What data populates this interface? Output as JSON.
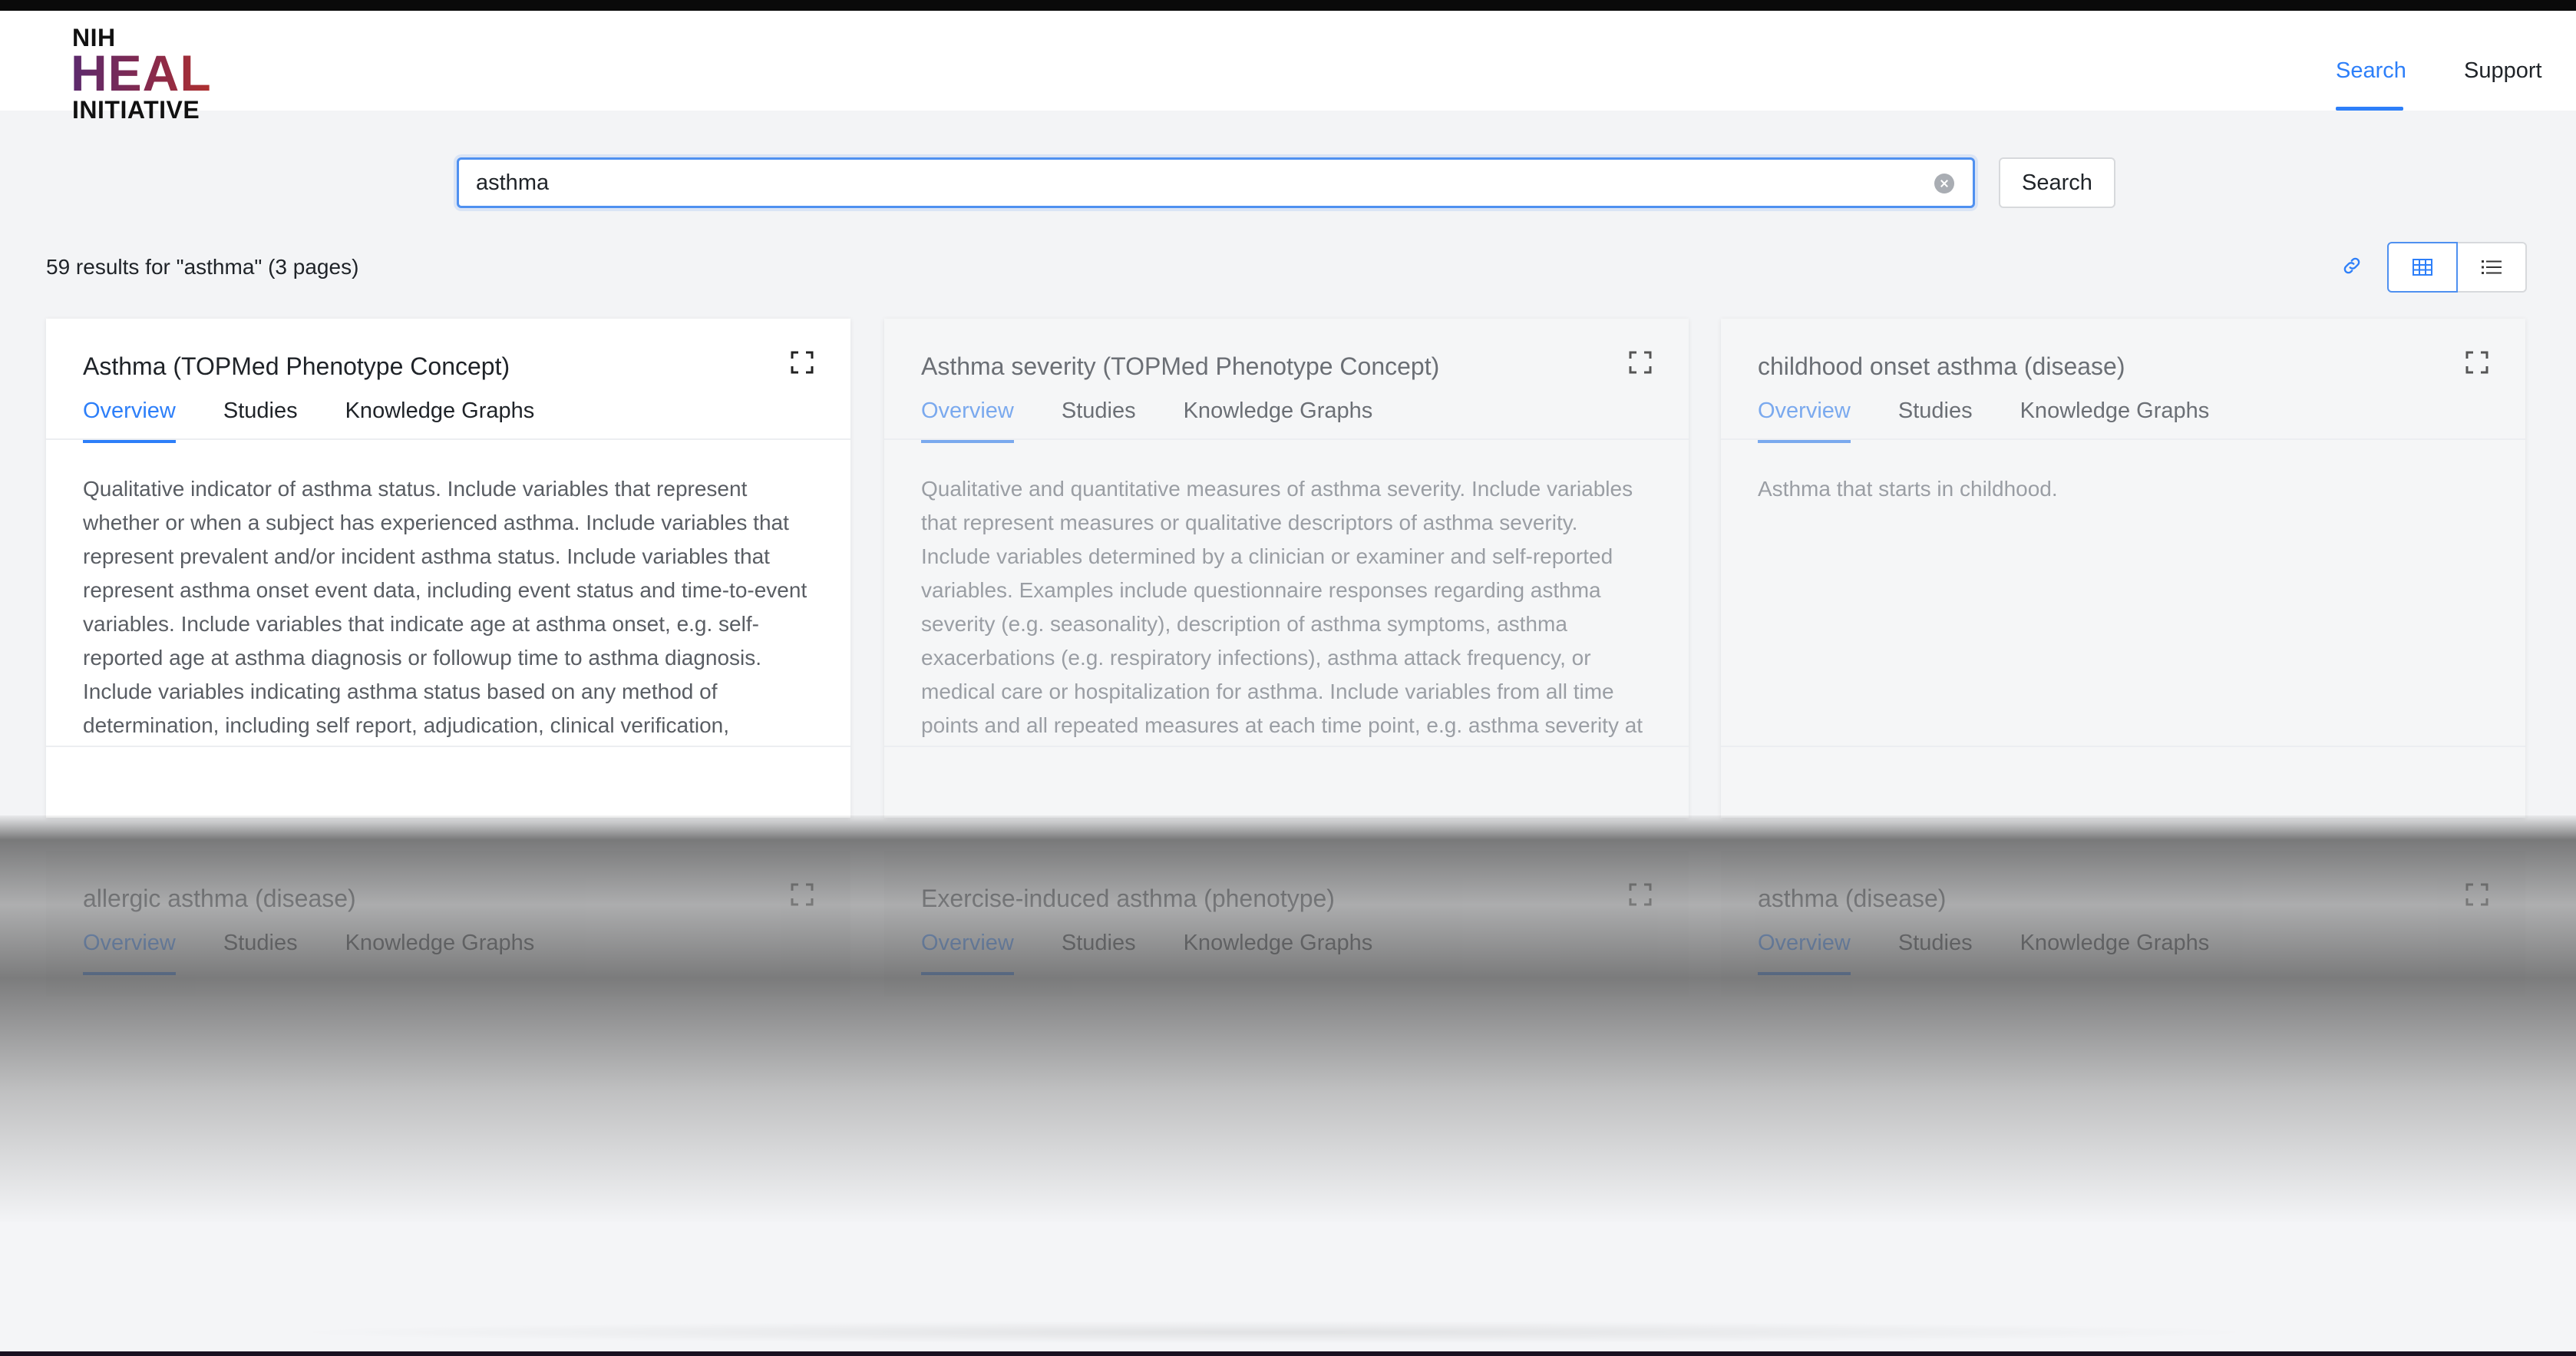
{
  "logo": {
    "line1": "NIH",
    "line2": "HEAL",
    "line3": "INITIATIVE"
  },
  "nav": {
    "search": "Search",
    "support": "Support"
  },
  "search": {
    "value": "asthma",
    "button": "Search"
  },
  "results": {
    "summary": "59 results for \"asthma\" (3 pages)"
  },
  "colors": {
    "accent": "#2d7ff9",
    "logo_gradient": [
      "#5b2a6e",
      "#b0302e"
    ]
  },
  "tabs": [
    "Overview",
    "Studies",
    "Knowledge Graphs"
  ],
  "cards": [
    {
      "title": "Asthma (TOPMed Phenotype Concept)",
      "description": "Qualitative indicator of asthma status. Include variables that represent whether or when a subject has experienced asthma. Include variables that represent prevalent and/or incident asthma status. Include variables that represent asthma onset event data, including event status and time-to-event variables. Include variables that indicate age at asthma onset, e.g. self-reported age at asthma diagnosis or followup time to asthma diagnosis. Include variables indicating asthma status based on any method of determination, including self report, adjudication, clinical verification,"
    },
    {
      "title": "Asthma severity (TOPMed Phenotype Concept)",
      "description": "Qualitative and quantitative measures of asthma severity. Include variables that represent measures or qualitative descriptors of asthma severity. Include variables determined by a clinician or examiner and self-reported variables. Examples include questionnaire responses regarding asthma severity (e.g. seasonality), description of asthma symptoms, asthma exacerbations (e.g. respiratory infections), asthma attack frequency, or medical care or hospitalization for asthma. Include variables from all time points and all repeated measures at each time point, e.g. asthma severity at"
    },
    {
      "title": "childhood onset asthma (disease)",
      "description": "Asthma that starts in childhood."
    },
    {
      "title": "allergic asthma (disease)"
    },
    {
      "title": "Exercise-induced asthma (phenotype)"
    },
    {
      "title": "asthma (disease)"
    }
  ]
}
